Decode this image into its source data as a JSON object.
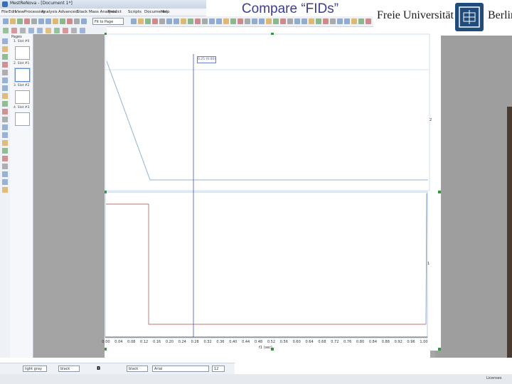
{
  "window": {
    "title": "MestReNova - [Document 1*]"
  },
  "menu": [
    "File",
    "Edit",
    "View",
    "Processing",
    "Analysis",
    "Advanced",
    "Stack",
    "Mass Analysis",
    "Predict",
    "Scripts",
    "Documents",
    "Help"
  ],
  "toolbar": {
    "zoom_value": "Fit to Page"
  },
  "slide": {
    "title": "Compare “FIDs”"
  },
  "logo": {
    "left_text": "Freie Universität",
    "right_text": "Berlin"
  },
  "pages_panel": {
    "title": "Pages",
    "pages": [
      {
        "label": "1. Slot #0"
      },
      {
        "label": "2. Slot #1"
      },
      {
        "label": "3. Slot #2"
      },
      {
        "label": "4. Slot #3"
      }
    ]
  },
  "plot": {
    "cursor_readout": "0.25 (0.00)",
    "spectrum_labels": [
      "2",
      "1"
    ],
    "x_axis_title": "f1 (sec)",
    "x_ticks": [
      "0.00",
      "0.04",
      "0.08",
      "0.12",
      "0.16",
      "0.20",
      "0.24",
      "0.28",
      "0.32",
      "0.36",
      "0.40",
      "0.44",
      "0.48",
      "0.52",
      "0.56",
      "0.60",
      "0.64",
      "0.68",
      "0.72",
      "0.76",
      "0.80",
      "0.84",
      "0.88",
      "0.92",
      "0.96",
      "1.00"
    ]
  },
  "bottom_toolbar": {
    "line_style": "light gray",
    "color": "black",
    "color2": "black",
    "font": "Arial",
    "font_size": "12"
  },
  "status": {
    "license": "Licenses"
  },
  "colors": {
    "spectrum_top": "#8fb3d0",
    "spectrum_bottom": "#c07070",
    "cursor": "#5566cc",
    "frame": "#c8d8ec"
  }
}
